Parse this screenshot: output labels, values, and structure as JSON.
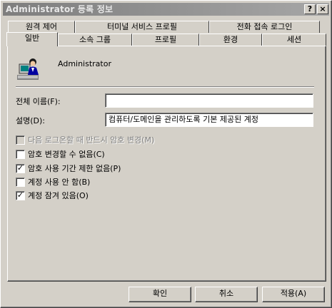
{
  "window": {
    "title": "Administrator 등록 정보",
    "help_button": "?",
    "close_button": "×"
  },
  "tabs_row1": [
    "원격 제어",
    "터미널 서비스 프로필",
    "전화 접속 로그인"
  ],
  "tabs_row2": [
    "일반",
    "소속 그룹",
    "프로필",
    "환경",
    "세션"
  ],
  "user": {
    "name": "Administrator"
  },
  "fields": {
    "fullname_label": "전체 이름(F):",
    "fullname_value": "",
    "description_label": "설명(D):",
    "description_value": "컴퓨터/도메인을 관리하도록 기본 제공된 계정"
  },
  "checkboxes": [
    {
      "label": "다음 로그온할 때 반드시 암호 변경(M)",
      "checked": false,
      "disabled": true
    },
    {
      "label": "암호 변경할 수 없음(C)",
      "checked": false,
      "disabled": false
    },
    {
      "label": "암호 사용 기간 제한 없음(P)",
      "checked": true,
      "disabled": false
    },
    {
      "label": "계정 사용 안 함(B)",
      "checked": false,
      "disabled": false
    },
    {
      "label": "계정 잠겨 있음(O)",
      "checked": true,
      "disabled": false
    }
  ],
  "buttons": {
    "ok": "확인",
    "cancel": "취소",
    "apply": "적용(A)"
  },
  "colors": {
    "face": "#d4d0c8",
    "title_bar": "#8c8c8c",
    "disabled_text": "#808080"
  }
}
